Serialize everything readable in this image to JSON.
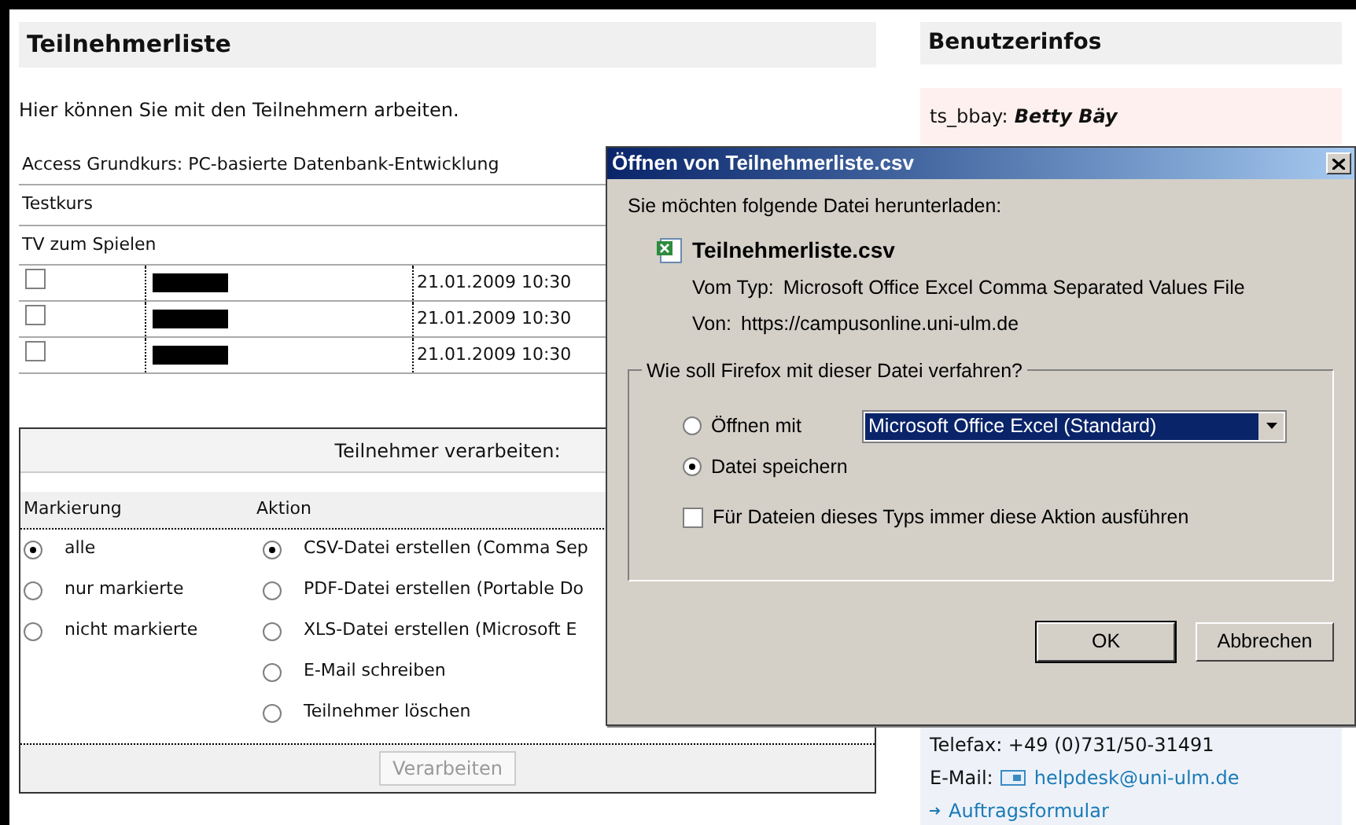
{
  "main": {
    "title": "Teilnehmerliste",
    "intro": "Hier können Sie mit den Teilnehmern arbeiten.",
    "courses": [
      "Access Grundkurs: PC-basierte Datenbank-Entwicklung",
      "Testkurs",
      "TV zum Spielen"
    ],
    "participants": [
      {
        "checked": false,
        "date": "21.01.2009 10:30"
      },
      {
        "checked": false,
        "date": "21.01.2009 10:30"
      },
      {
        "checked": false,
        "date": "21.01.2009 10:30"
      }
    ],
    "process": {
      "heading": "Teilnehmer verarbeiten:",
      "col_1": "Markierung",
      "col_2": "Aktion",
      "markierung": [
        {
          "label": "alle",
          "selected": true
        },
        {
          "label": "nur markierte",
          "selected": false
        },
        {
          "label": "nicht markierte",
          "selected": false
        }
      ],
      "aktion": [
        {
          "label": "CSV-Datei erstellen (Comma Sep",
          "selected": true
        },
        {
          "label": "PDF-Datei erstellen (Portable Do",
          "selected": false
        },
        {
          "label": "XLS-Datei erstellen (Microsoft E",
          "selected": false
        },
        {
          "label": "E-Mail schreiben",
          "selected": false
        },
        {
          "label": "Teilnehmer löschen",
          "selected": false
        }
      ],
      "button": "Verarbeiten"
    }
  },
  "sidebar": {
    "title": "Benutzerinfos",
    "user_id": "ts_bbay:",
    "user_name": "Betty Bäy",
    "telefax": "Telefax: +49 (0)731/50-31491",
    "email_label": "E-Mail:",
    "email": "helpdesk@uni-ulm.de",
    "link": "Auftragsformular"
  },
  "dialog": {
    "title": "Öffnen von Teilnehmerliste.csv",
    "prompt": "Sie möchten folgende Datei herunterladen:",
    "filename": "Teilnehmerliste.csv",
    "type_label": "Vom Typ:",
    "type": "Microsoft Office Excel Comma Separated Values File",
    "from_label": "Von:",
    "from": "https://campusonline.uni-ulm.de",
    "group": "Wie soll Firefox mit dieser Datei verfahren?",
    "options": [
      {
        "label": "Öffnen mit",
        "selected": false
      },
      {
        "label": "Datei speichern",
        "selected": true
      }
    ],
    "app": "Microsoft Office Excel (Standard)",
    "always": {
      "label": "Für Dateien dieses Typs immer diese Aktion ausführen",
      "checked": false
    },
    "buttons": [
      "OK",
      "Abbrechen"
    ]
  }
}
